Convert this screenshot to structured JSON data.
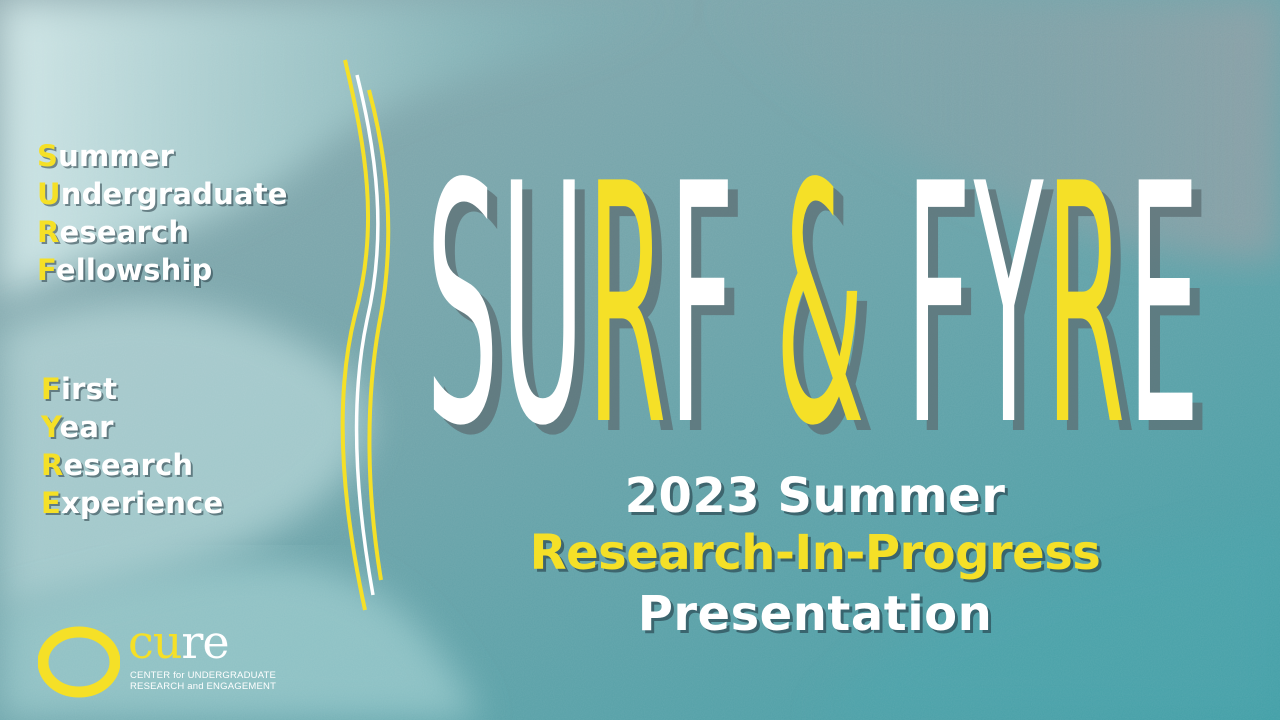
{
  "colors": {
    "accent_yellow": "#f5e027",
    "text_white": "#ffffff",
    "background_teal": "#4fa6ac",
    "background_gray": "#7d9aa3"
  },
  "acronym_surf": [
    {
      "initial": "S",
      "rest": "ummer"
    },
    {
      "initial": "U",
      "rest": "ndergraduate"
    },
    {
      "initial": "R",
      "rest": "esearch"
    },
    {
      "initial": "F",
      "rest": "ellowship"
    }
  ],
  "acronym_fyre": [
    {
      "initial": "F",
      "rest": "irst"
    },
    {
      "initial": "Y",
      "rest": "ear"
    },
    {
      "initial": "R",
      "rest": "esearch"
    },
    {
      "initial": "E",
      "rest": "xperience"
    }
  ],
  "title": {
    "text": "SURF & FYRE",
    "highlighted_letters": [
      "R",
      "&",
      "R"
    ]
  },
  "subtitle": {
    "line1": "2023 Summer",
    "line2": "Research-In-Progress",
    "line3": "Presentation"
  },
  "logo": {
    "letter": "O",
    "word_accent": "cu",
    "word_rest": "re",
    "tagline_line1": "CENTER for UNDERGRADUATE",
    "tagline_line2": "RESEARCH and ENGAGEMENT"
  }
}
